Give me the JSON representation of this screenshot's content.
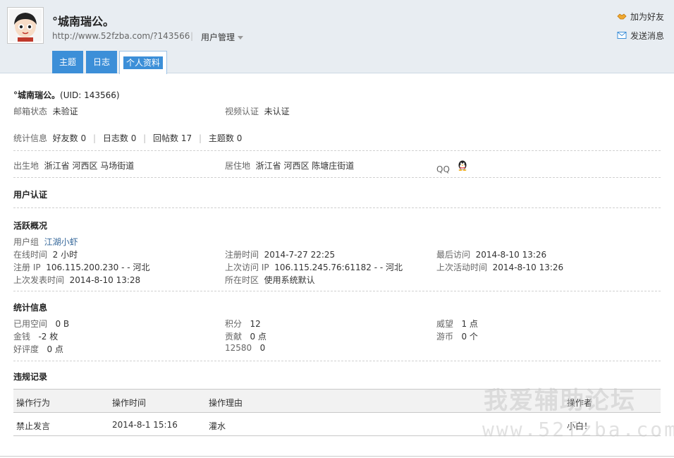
{
  "header": {
    "username": "°城南瑞公。",
    "url": "http://www.52fzba.com/?143566",
    "separator": "|",
    "manage_label": "用户管理",
    "tabs": [
      {
        "label": "主题"
      },
      {
        "label": "日志"
      },
      {
        "label": "个人资料"
      }
    ],
    "actions": {
      "add_friend": "加为好友",
      "send_message": "发送消息"
    }
  },
  "profile": {
    "name_line_name": "°城南瑞公。",
    "name_line_uid": "(UID: 143566)",
    "email_status_label": "邮箱状态",
    "email_status_value": "未验证",
    "video_label": "视频认证",
    "video_value": "未认证",
    "stats_label": "统计信息",
    "stats": [
      {
        "label": "好友数",
        "value": "0"
      },
      {
        "label": "日志数",
        "value": "0"
      },
      {
        "label": "回帖数",
        "value": "17"
      },
      {
        "label": "主题数",
        "value": "0"
      }
    ],
    "birthplace_label": "出生地",
    "birthplace_value": "浙江省 河西区 马场街道",
    "residence_label": "居住地",
    "residence_value": "浙江省 河西区 陈塘庄街道",
    "qq_label": "QQ",
    "user_cert_title": "用户认证"
  },
  "activity": {
    "title": "活跃概况",
    "group_label": "用户组",
    "group_value": "江湖小虾",
    "online_label": "在线时间",
    "online_value": "2 小时",
    "reg_time_label": "注册时间",
    "reg_time_value": "2014-7-27 22:25",
    "last_visit_label": "最后访问",
    "last_visit_value": "2014-8-10 13:26",
    "reg_ip_label": "注册 IP",
    "reg_ip_value": "106.115.200.230 - - 河北",
    "last_ip_label": "上次访问 IP",
    "last_ip_value": "106.115.245.76:61182 - - 河北",
    "last_active_label": "上次活动时间",
    "last_active_value": "2014-8-10 13:26",
    "last_post_label": "上次发表时间",
    "last_post_value": "2014-8-10 13:28",
    "timezone_label": "所在时区",
    "timezone_value": "使用系统默认"
  },
  "statistics": {
    "title": "统计信息",
    "space_label": "已用空间",
    "space_value": "0 B",
    "points_label": "积分",
    "points_value": "12",
    "prestige_label": "威望",
    "prestige_value": "1 点",
    "money_label": "金钱",
    "money_value": "-2 枚",
    "contribution_label": "贡献",
    "contribution_value": "0 点",
    "coin_label": "游币",
    "coin_value": "0 个",
    "rating_label": "好评度",
    "rating_value": "0 点",
    "extra_label": "12580",
    "extra_value": "0"
  },
  "violations": {
    "title": "违规记录",
    "columns": [
      "操作行为",
      "操作时间",
      "操作理由",
      "操作者"
    ],
    "rows": [
      {
        "action": "禁止发言",
        "time": "2014-8-1 15:16",
        "reason": "灌水",
        "operator": "小白！"
      }
    ]
  },
  "watermark": {
    "line1": "我爱辅助论坛",
    "line2": "www.52fzba.com"
  },
  "colors": {
    "tab_blue": "#3c8fd8",
    "header_bg": "#e8edf2",
    "link": "#336699"
  }
}
